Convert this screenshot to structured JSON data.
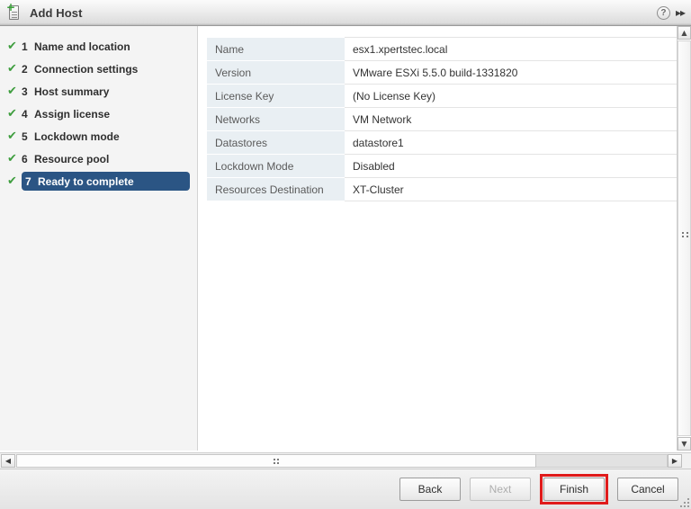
{
  "window": {
    "title": "Add Host",
    "icon": "add-host-icon",
    "help_label": "?",
    "expand_label": "▸▸"
  },
  "sidebar": {
    "steps": [
      {
        "num": "1",
        "label": "Name and location",
        "check": "✔",
        "selected": false
      },
      {
        "num": "2",
        "label": "Connection settings",
        "check": "✔",
        "selected": false
      },
      {
        "num": "3",
        "label": "Host summary",
        "check": "✔",
        "selected": false
      },
      {
        "num": "4",
        "label": "Assign license",
        "check": "✔",
        "selected": false
      },
      {
        "num": "5",
        "label": "Lockdown mode",
        "check": "✔",
        "selected": false
      },
      {
        "num": "6",
        "label": "Resource pool",
        "check": "✔",
        "selected": false
      },
      {
        "num": "7",
        "label": "Ready to complete",
        "check": "✔",
        "selected": true
      }
    ]
  },
  "summary": {
    "rows": [
      {
        "key": "Name",
        "value": "esx1.xpertstec.local"
      },
      {
        "key": "Version",
        "value": "VMware ESXi 5.5.0 build-1331820"
      },
      {
        "key": "License Key",
        "value": "(No License Key)"
      },
      {
        "key": "Networks",
        "value": "VM Network"
      },
      {
        "key": "Datastores",
        "value": "datastore1"
      },
      {
        "key": "Lockdown Mode",
        "value": "Disabled"
      },
      {
        "key": "Resources Destination",
        "value": "XT-Cluster"
      }
    ]
  },
  "footer": {
    "back_label": "Back",
    "next_label": "Next",
    "finish_label": "Finish",
    "cancel_label": "Cancel"
  },
  "scrollbars": {
    "v_up": "▲",
    "v_down": "▼",
    "h_left": "◀",
    "h_right": "▶"
  },
  "colors": {
    "selected_step": "#2b5584",
    "check_green": "#3f9e3f",
    "highlight_red": "#e01b1b",
    "key_cell_bg": "#e9eff3"
  }
}
